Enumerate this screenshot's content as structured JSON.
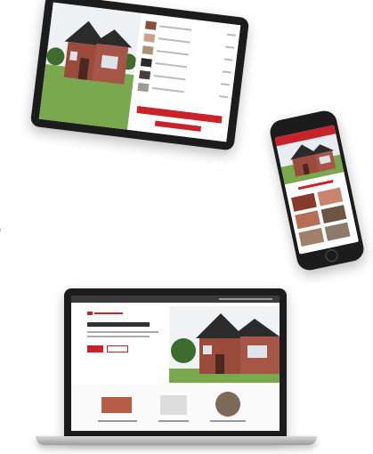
{
  "screenshot": {
    "description_free": true
  },
  "tablet": {
    "swatches": [
      {
        "color": "#8b4f3c"
      },
      {
        "color": "#c9a089"
      },
      {
        "color": "#a89477"
      },
      {
        "color": "#2a2a2a"
      },
      {
        "color": "#4a3a44"
      },
      {
        "color": "#9c9a93"
      }
    ]
  },
  "phone": {
    "tiles": [
      {
        "color": "#8a3a2a"
      },
      {
        "color": "#c98470"
      },
      {
        "color": "#b76e57"
      },
      {
        "color": "#6d5544"
      },
      {
        "color": "#a08068"
      },
      {
        "color": "#8c7a6a"
      }
    ]
  },
  "laptop": {
    "feature_images": [
      {
        "color": "#b85d45"
      },
      {
        "color": "#dcdcdc"
      },
      {
        "color": "#7b6a5a"
      }
    ]
  },
  "edge_glyph": ")",
  "colors": {
    "brand_red": "#c8222a",
    "device_black": "#1c1c1c",
    "brick": "#9a4b3c",
    "roof": "#2b2b2b",
    "grass": "#7aa84e"
  }
}
